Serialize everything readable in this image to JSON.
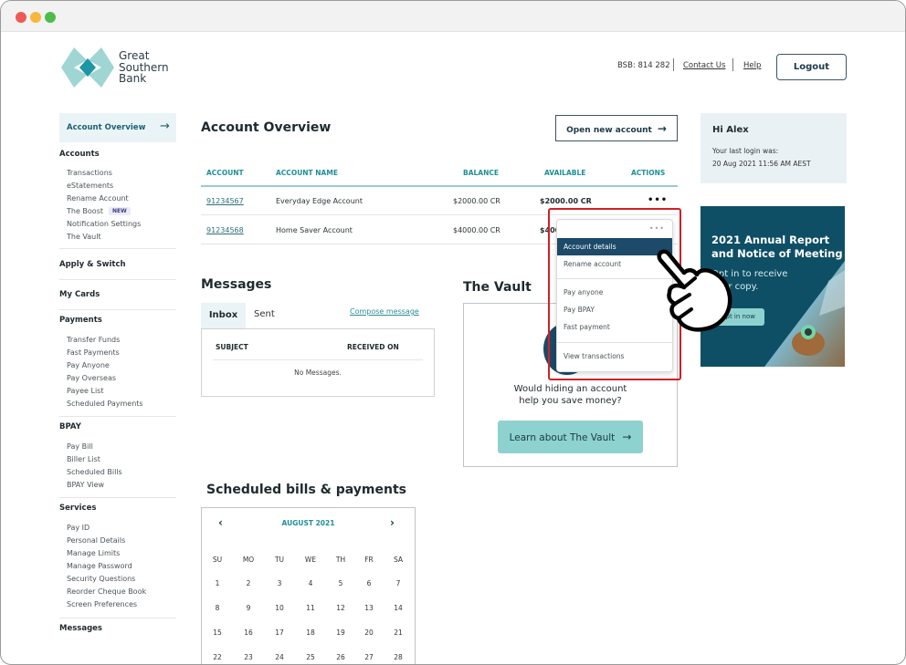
{
  "header": {
    "logo_text": [
      "Great",
      "Southern",
      "Bank"
    ],
    "bsb": "BSB: 814 282",
    "contact": "Contact Us",
    "help": "Help",
    "logout": "Logout"
  },
  "sidebar": {
    "active": {
      "label": "Account Overview",
      "icon": "arrow-right-icon"
    },
    "sections": [
      {
        "title": "Accounts",
        "items": [
          "Transactions",
          "eStatements",
          "Rename Account",
          "The Boost",
          "Notification Settings",
          "The Vault"
        ]
      },
      {
        "title": "Apply & Switch",
        "items": []
      },
      {
        "title": "My Cards",
        "items": []
      },
      {
        "title": "Payments",
        "items": [
          "Transfer Funds",
          "Fast Payments",
          "Pay Anyone",
          "Pay Overseas",
          "Payee List",
          "Scheduled Payments"
        ]
      },
      {
        "title": "BPAY",
        "items": [
          "Pay Bill",
          "Biller List",
          "Scheduled Bills",
          "BPAY View"
        ]
      },
      {
        "title": "Services",
        "items": [
          "Pay ID",
          "Personal Details",
          "Manage Limits",
          "Manage Password",
          "Security Questions",
          "Reorder Cheque Book",
          "Screen Preferences"
        ]
      },
      {
        "title": "Messages",
        "items": []
      }
    ],
    "new_badge": "NEW"
  },
  "overview": {
    "title": "Account Overview",
    "open_button": "Open new account",
    "columns": [
      "ACCOUNT",
      "ACCOUNT NAME",
      "BALANCE",
      "AVAILABLE",
      "ACTIONS"
    ],
    "rows": [
      {
        "account": "91234567",
        "name": "Everyday Edge Account",
        "balance": "$2000.00 CR",
        "available": "$2000.00 CR",
        "actions": "•••"
      },
      {
        "account": "91234568",
        "name": "Home Saver Account",
        "balance": "$4000.00 CR",
        "available": "$4000.00 CR",
        "actions": "•••"
      }
    ]
  },
  "actions_menu": {
    "dots": "•••",
    "items": [
      "Account details",
      "Rename account",
      "Pay anyone",
      "Pay BPAY",
      "Fast payment",
      "View transactions"
    ],
    "active_item": "Account details",
    "highlight_color": "#d21f26"
  },
  "messages": {
    "title": "Messages",
    "tabs": [
      "Inbox",
      "Sent"
    ],
    "active_tab": "Inbox",
    "compose": "Compose message",
    "columns": [
      "SUBJECT",
      "RECEIVED ON"
    ],
    "empty": "No Messages."
  },
  "vault": {
    "title": "The Vault",
    "text_line1": "Would hiding an account",
    "text_line2": "help you save money?",
    "button": "Learn about The Vault"
  },
  "greeting": {
    "name": "Hi Alex",
    "line1": "Your last login was:",
    "line2": "20 Aug 2021 11:56 AM AEST"
  },
  "promo": {
    "title_line1": "2021 Annual Report",
    "title_line2": "and Notice of Meeting",
    "sub_line1": "Opt in to receive",
    "sub_line2": "your copy.",
    "button": "Opt in now"
  },
  "calendar": {
    "title": "Scheduled bills & payments",
    "month": "AUGUST 2021",
    "weekdays": [
      "SU",
      "MO",
      "TU",
      "WE",
      "TH",
      "FR",
      "SA"
    ],
    "weeks": [
      [
        "1",
        "2",
        "3",
        "4",
        "5",
        "6",
        "7"
      ],
      [
        "8",
        "9",
        "10",
        "11",
        "12",
        "13",
        "14"
      ],
      [
        "15",
        "16",
        "17",
        "18",
        "19",
        "20",
        "21"
      ],
      [
        "22",
        "23",
        "24",
        "25",
        "26",
        "27",
        "28"
      ]
    ]
  },
  "colors": {
    "brand_teal": "#1f8d97",
    "brand_navy": "#1c4a68",
    "accent_mint": "#8ed2cf"
  }
}
